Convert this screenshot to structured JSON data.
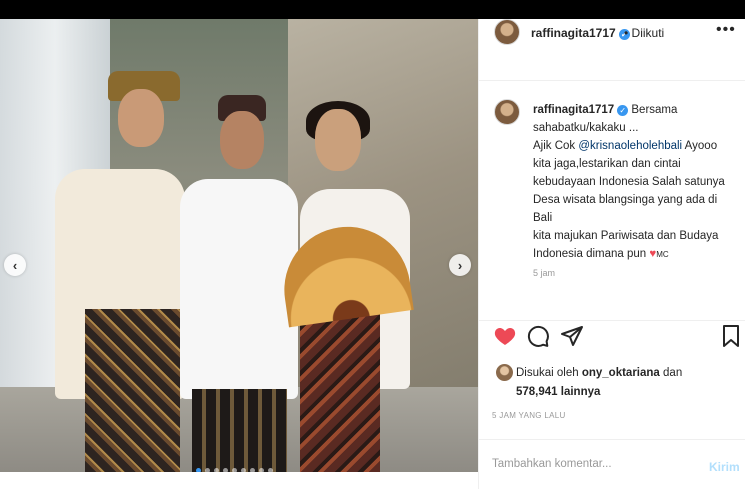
{
  "header": {
    "username": "raffinagita1717",
    "separator": "•",
    "follow_status": "Diikuti",
    "more_label": "•••"
  },
  "caption": {
    "username": "raffinagita1717",
    "lines": [
      "Bersama",
      "sahabatku/kakaku ...",
      "Ajik Cok ",
      "@krisnaoleholehbali",
      " Ayooo",
      "kita jaga,lestarikan dan cintai",
      "kebudayaan Indonesia Salah satunya",
      "Desa wisata blangsinga yang ada di",
      "Bali",
      "kita majukan Pariwisata dan Budaya",
      "Indonesia dimana pun ",
      "MC"
    ],
    "heart": "♥",
    "cut_time": "5 jam"
  },
  "likes": {
    "prefix": "Disukai oleh ",
    "user": "ony_oktariana",
    "middle": " dan",
    "count": "578,941",
    "suffix": " lainnya"
  },
  "post_time": "5 JAM YANG LALU",
  "comment": {
    "placeholder": "Tambahkan komentar...",
    "post_label": "Kirim"
  },
  "carousel": {
    "prev_label": "‹",
    "next_label": "›",
    "dot_count": 9,
    "active_index": 0
  },
  "icons": {
    "like": "heart-filled-icon",
    "comment": "comment-bubble-icon",
    "share": "share-arrow-icon",
    "save": "bookmark-icon"
  },
  "colors": {
    "like_red": "#ed4956",
    "verified_blue": "#3897f0",
    "mention_blue": "#003569",
    "post_button_disabled": "#b2dffc"
  }
}
